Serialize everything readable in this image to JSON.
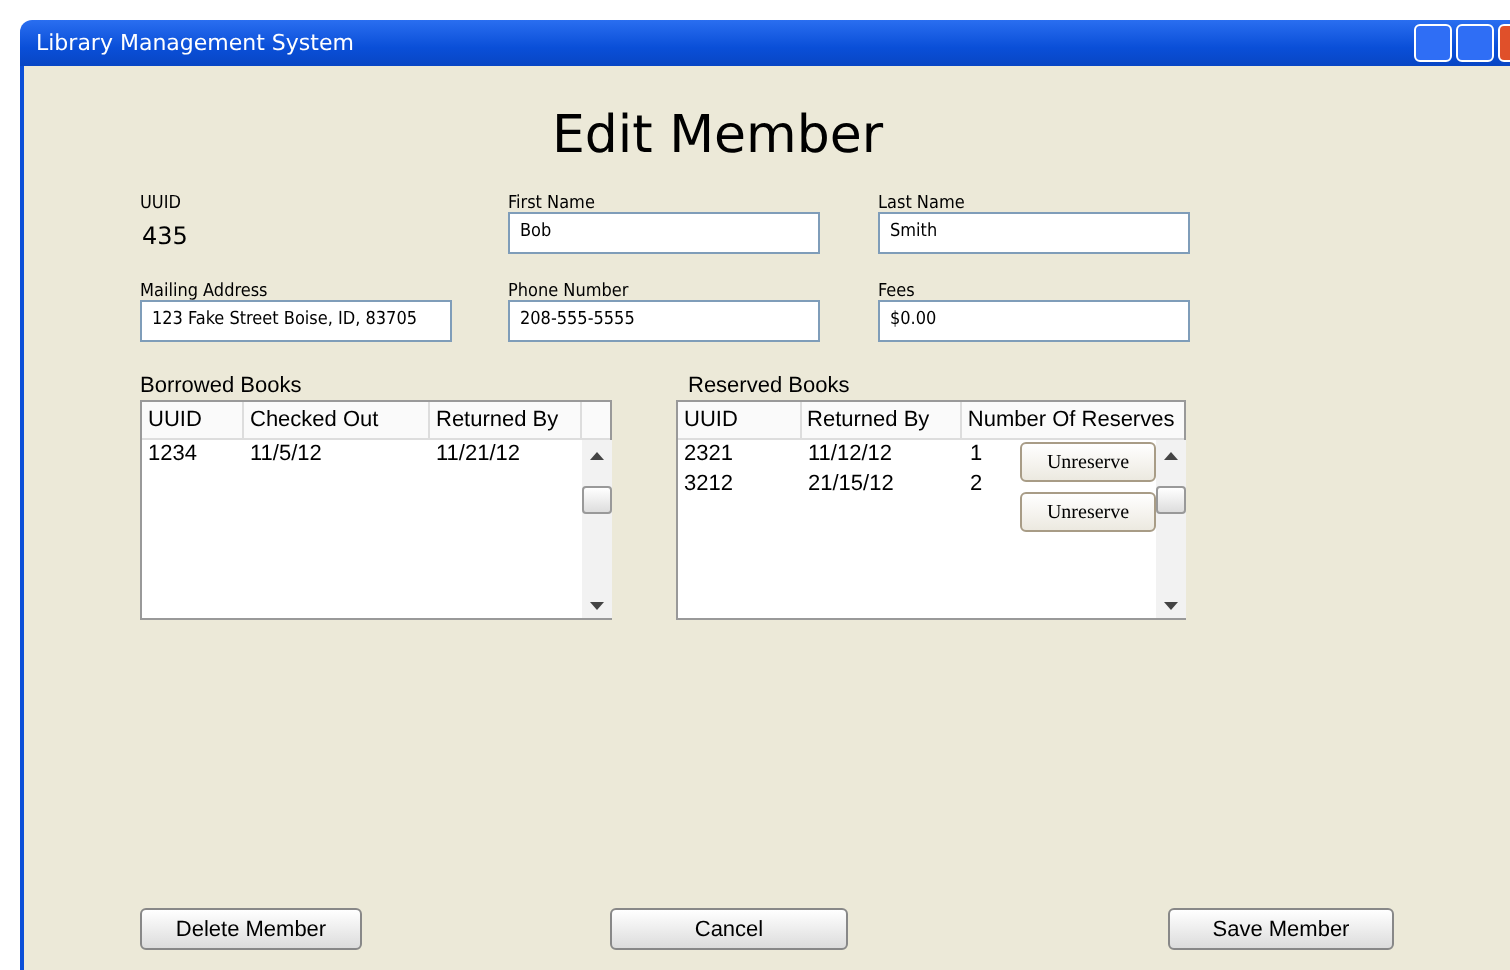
{
  "window": {
    "title": "Library Management System"
  },
  "heading": "Edit Member",
  "fields": [
    {
      "label": "UUID",
      "kind": "static",
      "value": "435"
    },
    {
      "label": "First Name",
      "kind": "input",
      "value": "Bob"
    },
    {
      "label": "Last Name",
      "kind": "input",
      "value": "Smith"
    },
    {
      "label": "Mailing Address",
      "kind": "input",
      "value": "123 Fake Street Boise, ID, 83705"
    },
    {
      "label": "Phone Number",
      "kind": "input",
      "value": "208-555-5555"
    },
    {
      "label": "Fees",
      "kind": "input",
      "value": "$0.00"
    }
  ],
  "borrowed_books": {
    "title": "Borrowed Books",
    "columns": [
      "UUID",
      "Checked Out",
      "Returned By"
    ],
    "rows": [
      [
        "1234",
        "11/5/12",
        "11/21/12"
      ]
    ]
  },
  "reserved_books": {
    "title": "Reserved Books",
    "columns": [
      "UUID",
      "Returned By",
      "Number Of Reserves"
    ],
    "rows": [
      {
        "cells": [
          "2321",
          "11/12/12",
          "1"
        ],
        "action": "Unreserve"
      },
      {
        "cells": [
          "3212",
          "21/15/12",
          "2"
        ],
        "action": "Unreserve"
      }
    ]
  },
  "buttons": [
    "Delete Member",
    "Cancel",
    "Save Member"
  ]
}
